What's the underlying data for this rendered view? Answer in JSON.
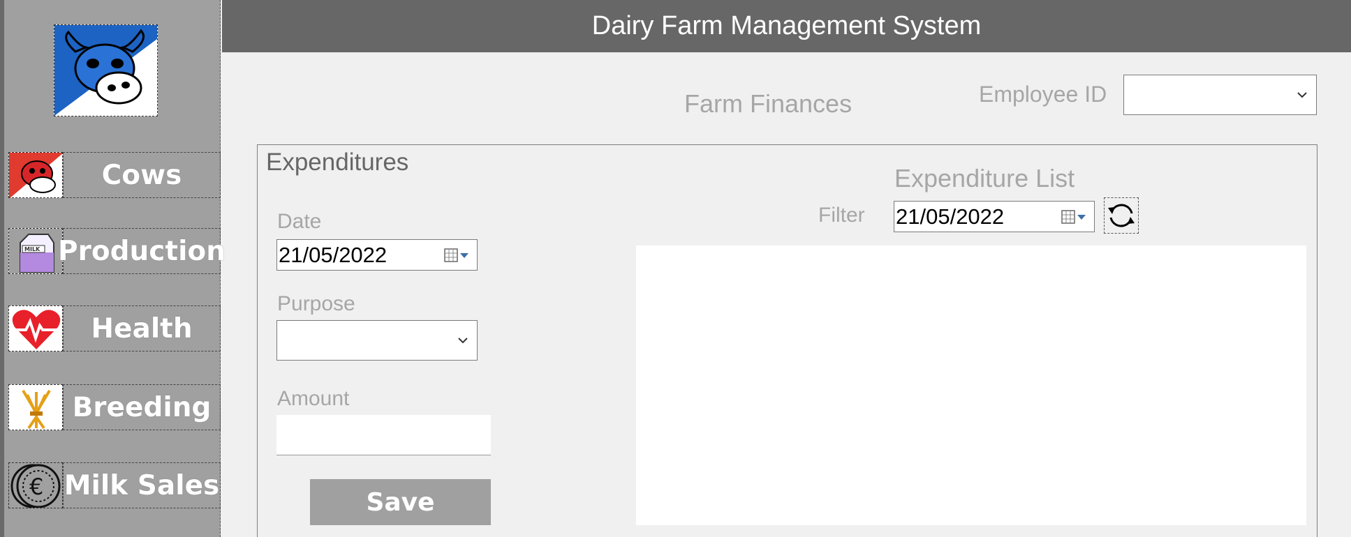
{
  "app": {
    "title": "Dairy Farm Management System"
  },
  "sidebar": {
    "logo_icon": "blue-cow-logo",
    "items": [
      {
        "label": "Cows",
        "icon": "cow-icon"
      },
      {
        "label": "Production",
        "icon": "milk-carton-icon"
      },
      {
        "label": "Health",
        "icon": "heart-pulse-icon"
      },
      {
        "label": "Breeding",
        "icon": "wheat-icon"
      },
      {
        "label": "Milk Sales",
        "icon": "euro-coin-icon"
      }
    ]
  },
  "page": {
    "title": "Farm Finances",
    "employee_label": "Employee ID",
    "employee_value": ""
  },
  "expenditures": {
    "title": "Expenditures",
    "date_label": "Date",
    "date_value": "21/05/2022",
    "purpose_label": "Purpose",
    "purpose_value": "",
    "amount_label": "Amount",
    "amount_value": "",
    "save_label": "Save"
  },
  "expenditure_list": {
    "title": "Expenditure List",
    "filter_label": "Filter",
    "filter_date": "21/05/2022",
    "rows": []
  },
  "colors": {
    "header": "#676767",
    "sidebar": "#a0a0a0",
    "accent_blue": "#1a5fbf",
    "heart_red": "#e8202a"
  }
}
